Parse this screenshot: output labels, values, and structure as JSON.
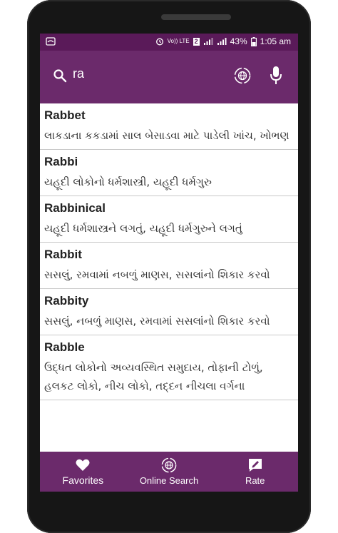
{
  "status_bar": {
    "volte": "Vo)) LTE",
    "sim": "2",
    "battery": "43%",
    "time": "1:05 am"
  },
  "search": {
    "query": "ra"
  },
  "entries": [
    {
      "word": "Rabbet",
      "meaning": "લાકડાના કકડામાં સાલ બેસાડવા માટે પાડેલી ખાંચ, ખોભણ"
    },
    {
      "word": "Rabbi",
      "meaning": "યહૂદી લોકોનો ધર્મશાસ્ત્રી, યહૂદી ધર્મગુરુ"
    },
    {
      "word": "Rabbinical",
      "meaning": "યહૂદી ધર્મશાસ્ત્રને લગતું, યહૂદી ધર્મગુરુને લગતું"
    },
    {
      "word": "Rabbit",
      "meaning": "સસલું, રમવામાં નબળું માણસ, સસલાંનો શિકાર કરવો"
    },
    {
      "word": "Rabbity",
      "meaning": "સસલું, નબળું માણસ, રમવામાં સસલાંનો શિકાર કરવો"
    },
    {
      "word": "Rabble",
      "meaning": "ઉદ્ધત લોકોનો અવ્યવસ્થિત સમુદાય, તોફાની ટોળું, હલકટ લોકો, નીચ લોકો, તદ્દન નીચલા વર્ગના"
    }
  ],
  "bottom_nav": {
    "favorites": "Favorites",
    "online_search": "Online Search",
    "rate": "Rate"
  },
  "colors": {
    "primary": "#6b2a6b",
    "status": "#5a1a59"
  }
}
